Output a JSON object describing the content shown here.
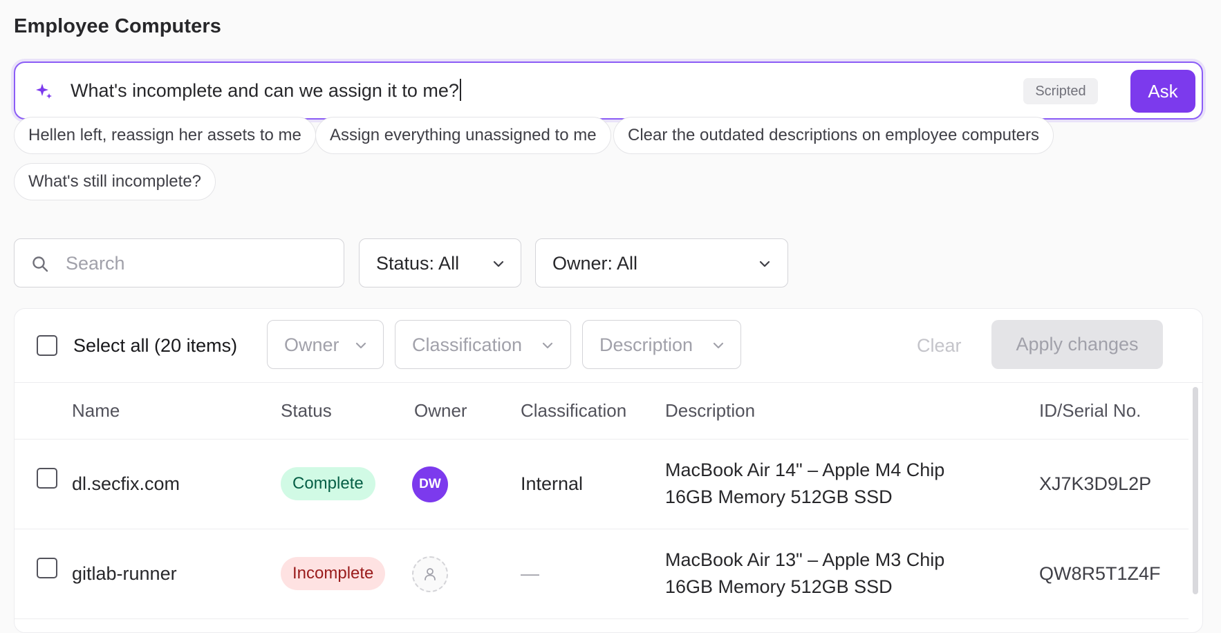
{
  "page": {
    "title": "Employee Computers"
  },
  "ask": {
    "query": "What's incomplete and can we assign it to me?",
    "badge": "Scripted",
    "button_label": "Ask",
    "icon": "sparkle-icon",
    "accent_color": "#7c3aed"
  },
  "suggestions": [
    "Hellen left, reassign her assets to me",
    "Assign everything unassigned to me",
    "Clear the outdated descriptions on employee computers",
    "What's still incomplete?"
  ],
  "filters": {
    "search_placeholder": "Search",
    "status_label": "Status: All",
    "owner_label": "Owner: All"
  },
  "bulk": {
    "select_all_label": "Select all (20 items)",
    "owner_label": "Owner",
    "classification_label": "Classification",
    "description_label": "Description",
    "clear_label": "Clear",
    "apply_label": "Apply changes"
  },
  "table": {
    "columns": [
      "Name",
      "Status",
      "Owner",
      "Classification",
      "Description",
      "ID/Serial No."
    ],
    "rows": [
      {
        "name": "dl.secfix.com",
        "status": "Complete",
        "status_color": "#065f46",
        "owner_initials": "DW",
        "classification": "Internal",
        "description_line1": "MacBook Air 14\" – Apple M4 Chip",
        "description_line2": "16GB Memory 512GB SSD",
        "serial": "XJ7K3D9L2P"
      },
      {
        "name": "gitlab-runner",
        "status": "Incomplete",
        "status_color": "#991b1b",
        "owner_initials": "",
        "classification": "—",
        "description_line1": "MacBook Air 13\" – Apple M3 Chip",
        "description_line2": "16GB Memory 512GB SSD",
        "serial": "QW8R5T1Z4F"
      }
    ]
  }
}
